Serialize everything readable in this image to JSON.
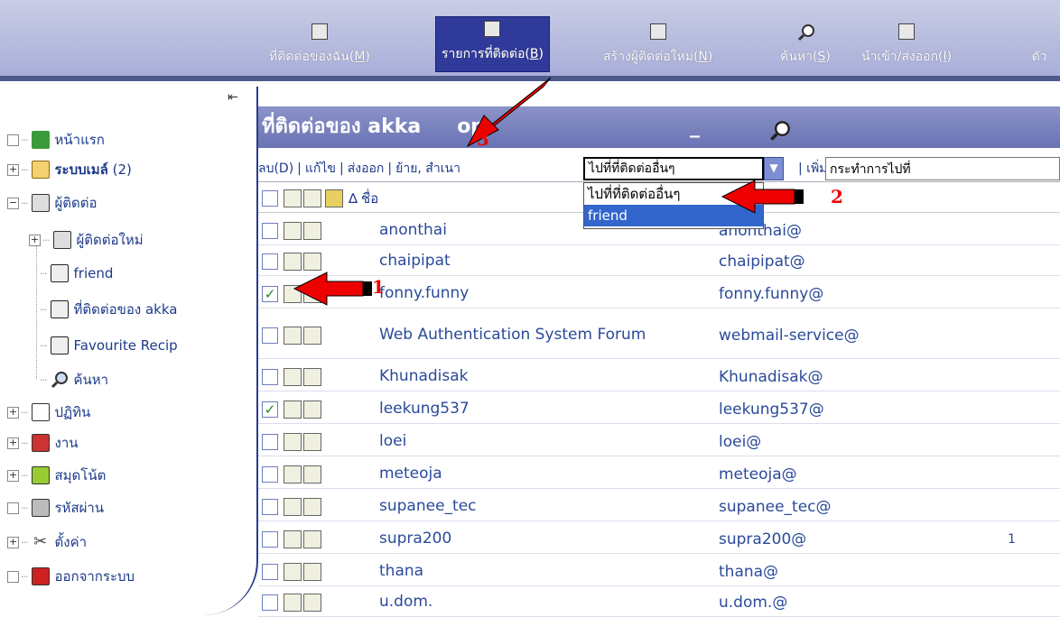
{
  "toolbar": {
    "buttons": [
      {
        "label": "ที่ติดต่อของฉัน",
        "key": "M",
        "icon": "card-icon"
      },
      {
        "label": "รายการที่ติดต่อ",
        "key": "B",
        "icon": "contacts-list-icon",
        "active": true
      },
      {
        "label": "สร้างผู้ติดต่อใหม่",
        "key": "N",
        "icon": "new-contact-icon"
      },
      {
        "label": "ค้นหา",
        "key": "S",
        "icon": "search-icon"
      },
      {
        "label": "นำเข้า/ส่งออก",
        "key": "I",
        "icon": "import-export-icon"
      },
      {
        "label": "ตัว",
        "key": "",
        "icon": "more-icon"
      }
    ]
  },
  "sidebar": {
    "items": [
      {
        "label": "หน้าแรก",
        "icon": "home-icon",
        "expander": "□"
      },
      {
        "label": "ระบบเมล์",
        "count": "(2)",
        "icon": "mail-icon",
        "expander": "+"
      },
      {
        "label": "ผู้ติดต่อ",
        "icon": "contacts-icon",
        "expander": "−"
      },
      {
        "label": "ผู้ติดต่อใหม่",
        "icon": "new-contact-icon",
        "expander": "+"
      },
      {
        "label": "friend",
        "icon": "contact-list-icon"
      },
      {
        "label": "ที่ติดต่อของ akka",
        "icon": "contact-list-icon"
      },
      {
        "label": "Favourite Recip",
        "icon": "contact-list-icon"
      },
      {
        "label": "ค้นหา",
        "icon": "search-icon"
      },
      {
        "label": "ปฏิทิน",
        "icon": "calendar-icon",
        "expander": "+"
      },
      {
        "label": "งาน",
        "icon": "task-icon",
        "expander": "+"
      },
      {
        "label": "สมุดโน้ต",
        "icon": "notepad-icon",
        "expander": "+"
      },
      {
        "label": "รหัสผ่าน",
        "icon": "lock-icon",
        "expander": "□"
      },
      {
        "label": "ตั้งค่า",
        "icon": "settings-icon",
        "expander": "+"
      },
      {
        "label": "ออกจากระบบ",
        "icon": "logout-icon",
        "expander": "□"
      }
    ]
  },
  "main": {
    "title": "ที่ติดต่อของ akka",
    "title_tail": "op",
    "actions": [
      "ลบ(D)",
      "แก้ไข",
      "ส่งออก",
      "ย้าย, สำเนา"
    ],
    "goto_select": {
      "value": "ไปที่ที่ติดต่ออื่นๆ",
      "options": [
        "ไปที่ที่ติดต่ออื่นๆ",
        "friend"
      ]
    },
    "add_label": "เพิ่ม",
    "add_value": "กระทำการไปที่",
    "column_name": "ชื่อ",
    "sort_indicator": "∆",
    "rows": [
      {
        "name": "anonthai",
        "email": "anonthai@",
        "checked": false
      },
      {
        "name": "chaipipat",
        "email": "chaipipat@",
        "checked": false
      },
      {
        "name": "fonny.funny",
        "email": "fonny.funny@",
        "checked": true
      },
      {
        "name": "Web Authentication System Forum",
        "email": "webmail-service@",
        "checked": false
      },
      {
        "name": "Khunadisak",
        "email": "Khunadisak@",
        "checked": false
      },
      {
        "name": "leekung537",
        "email": "leekung537@",
        "checked": true
      },
      {
        "name": "loei",
        "email": "loei@",
        "checked": false
      },
      {
        "name": "meteoja",
        "email": "meteoja@",
        "checked": false
      },
      {
        "name": "supanee_tec",
        "email": "supanee_tec@",
        "checked": false
      },
      {
        "name": "supra200",
        "email": "supra200@",
        "checked": false,
        "extra": "1"
      },
      {
        "name": "thana",
        "email": "thana@",
        "checked": false
      },
      {
        "name": "u.dom.",
        "email": "u.dom.@",
        "checked": false
      }
    ]
  },
  "annotations": {
    "n1": "1",
    "n2": "2",
    "n3": "3"
  },
  "colors": {
    "toolbar": "#b4b9de",
    "active_button": "#2f3a9a",
    "header": "#7a82be",
    "arrow": "#e00000"
  }
}
